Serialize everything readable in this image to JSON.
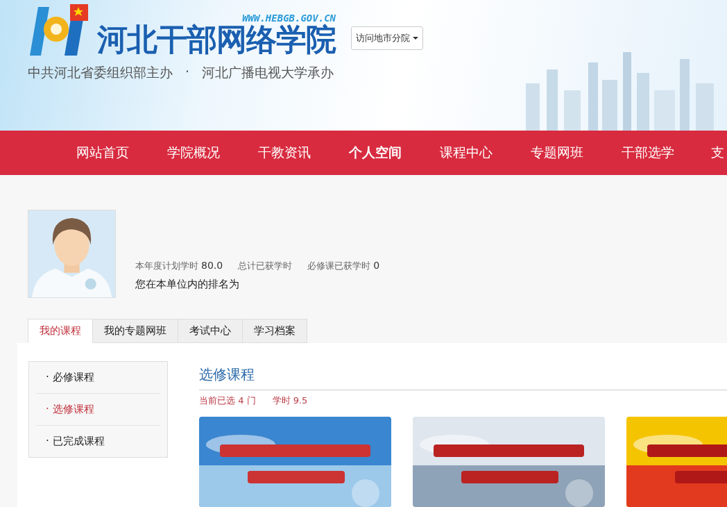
{
  "header": {
    "site_url": "WWW.HEBGB.GOV.CN",
    "site_name": "河北干部网络学院",
    "sponsor": "中共河北省委组织部主办",
    "separator": "·",
    "co_sponsor": "河北广播电视大学承办",
    "branch_dropdown": "访问地市分院"
  },
  "nav": [
    {
      "label": "网站首页",
      "selected": false
    },
    {
      "label": "学院概况",
      "selected": false
    },
    {
      "label": "干教资讯",
      "selected": false
    },
    {
      "label": "个人空间",
      "selected": true
    },
    {
      "label": "课程中心",
      "selected": false
    },
    {
      "label": "专题网班",
      "selected": false
    },
    {
      "label": "干部选学",
      "selected": false
    },
    {
      "label": "支",
      "selected": false
    }
  ],
  "profile": {
    "stats": [
      {
        "label": "本年度计划学时",
        "value": "80.0"
      },
      {
        "label": "总计已获学时"
      },
      {
        "label": "必修课已获学时",
        "value": "0"
      }
    ],
    "ranking": "您在本单位内的排名为"
  },
  "tabs": [
    {
      "label": "我的课程",
      "selected": true
    },
    {
      "label": "我的专题网班",
      "selected": false
    },
    {
      "label": "考试中心",
      "selected": false
    },
    {
      "label": "学习档案",
      "selected": false
    }
  ],
  "sidebar": [
    {
      "label": "· 必修课程",
      "selected": false
    },
    {
      "label": "· 选修课程",
      "selected": true
    },
    {
      "label": "· 已完成课程",
      "selected": false
    }
  ],
  "section": {
    "title": "选修课程",
    "selected_count": "当前已选 4 门",
    "hours": "学时 9.5"
  }
}
